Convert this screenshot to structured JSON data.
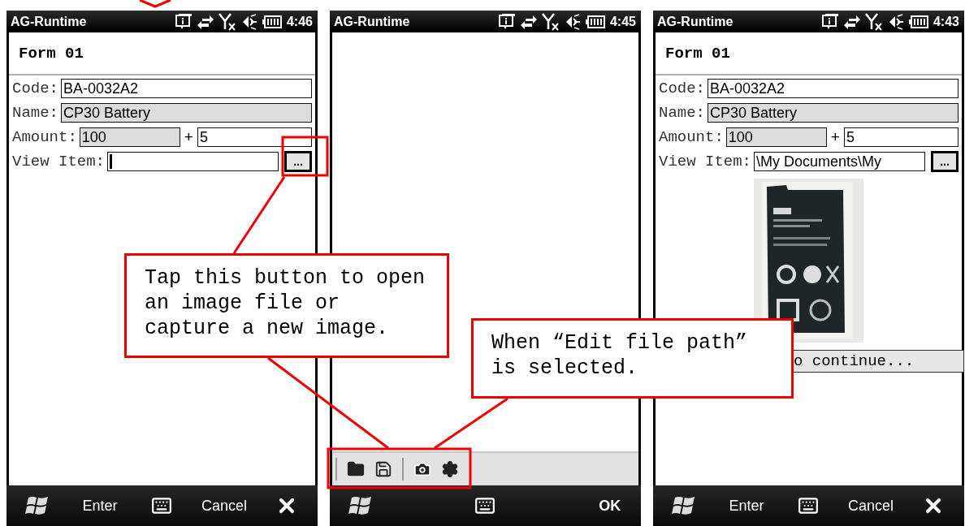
{
  "phones": [
    {
      "kind": "form",
      "status": {
        "app": "AG-Runtime",
        "time": "4:46"
      },
      "form": {
        "title": "Form 01",
        "fields": [
          {
            "kind": "text",
            "label": "Code:",
            "value": "BA-0032A2",
            "readonly": false
          },
          {
            "kind": "text",
            "label": "Name:",
            "value": "CP30 Battery",
            "readonly": true
          },
          {
            "kind": "sum",
            "label": "Amount:",
            "value": "100",
            "readonly": true,
            "plus": "+",
            "addend": "5"
          },
          {
            "kind": "file",
            "label": "View Item:",
            "browse": "...",
            "cursor": true
          }
        ]
      },
      "bottom": {
        "left": "Enter",
        "right": "Cancel"
      }
    },
    {
      "kind": "picker",
      "status": {
        "app": "AG-Runtime",
        "time": "4:45"
      },
      "bottom": {
        "right": "OK"
      }
    },
    {
      "kind": "form",
      "status": {
        "app": "AG-Runtime",
        "time": "4:43"
      },
      "form": {
        "title": "Form 01",
        "fields": [
          {
            "kind": "text",
            "label": "Code:",
            "value": "BA-0032A2",
            "readonly": false
          },
          {
            "kind": "text",
            "label": "Name:",
            "value": "CP30 Battery",
            "readonly": true
          },
          {
            "kind": "sum",
            "label": "Amount:",
            "value": "100",
            "readonly": true,
            "plus": "+",
            "addend": "5"
          },
          {
            "kind": "file",
            "label": "View Item:",
            "value": "\\My Documents\\My",
            "browse": "...",
            "cursor": false
          }
        ]
      },
      "message": "o continue...",
      "bottom": {
        "left": "Enter",
        "right": "Cancel"
      }
    }
  ],
  "callouts": [
    {
      "text": "Tap this button to open an image file or capture a new image."
    },
    {
      "text": "When “Edit file path” is selected."
    }
  ]
}
